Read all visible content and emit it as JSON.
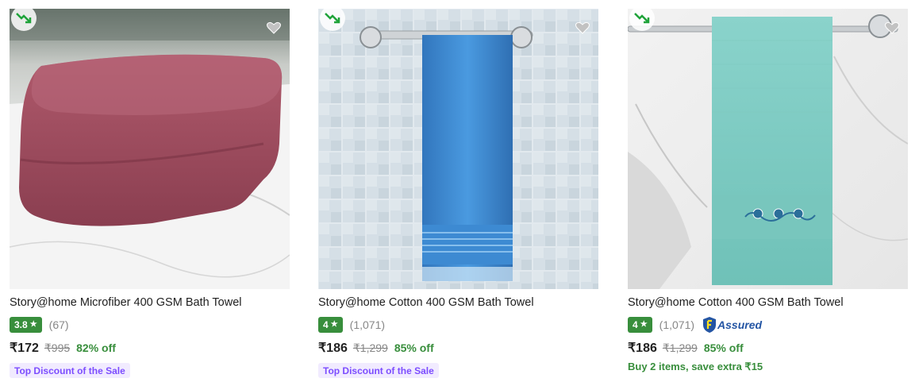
{
  "products": [
    {
      "title": "Story@home Microfiber 400 GSM Bath Towel",
      "rating": "3.8",
      "reviews": "(67)",
      "price": "₹172",
      "mrp": "₹995",
      "discount": "82% off",
      "promo": "Top Discount of the Sale",
      "color": "#9c4a5c"
    },
    {
      "title": "Story@home Cotton 400 GSM Bath Towel",
      "rating": "4",
      "reviews": "(1,071)",
      "price": "₹186",
      "mrp": "₹1,299",
      "discount": "85% off",
      "promo": "Top Discount of the Sale",
      "color": "#3f8fd2"
    },
    {
      "title": "Story@home Cotton 400 GSM Bath Towel",
      "rating": "4",
      "reviews": "(1,071)",
      "assured_label": "Assured",
      "price": "₹186",
      "mrp": "₹1,299",
      "discount": "85% off",
      "promo": "Buy 2 items, save extra ₹15",
      "color": "#7ccbc2"
    }
  ],
  "colors": {
    "rating_green": "#388e3c",
    "discount_green": "#388e3c",
    "promo_purple": "#7c4dff",
    "assured_blue": "#2455a4"
  },
  "icons": {
    "trend": "trending-down-icon",
    "wishlist": "heart-icon",
    "star": "star-icon",
    "assured": "flipkart-assured-icon"
  }
}
